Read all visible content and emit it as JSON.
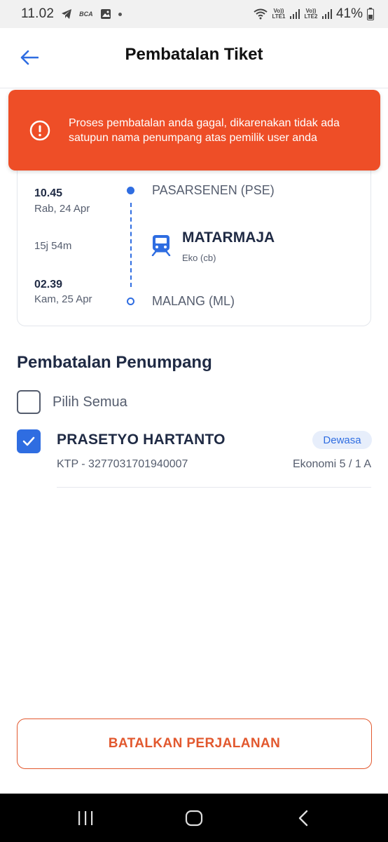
{
  "status_bar": {
    "time": "11.02",
    "bank_label": "BCA",
    "sim1_label": "Vo)) LTE1",
    "sim2_label": "Vo)) LTE2",
    "battery": "41%"
  },
  "header": {
    "title": "Pembatalan Tiket"
  },
  "alert": {
    "message": "Proses pembatalan anda gagal, dikarenakan tidak ada satupun nama penumpang atas pemilik user anda",
    "color": "#ee4e27"
  },
  "journey": {
    "departure_time": "10.45",
    "departure_date": "Rab, 24 Apr",
    "duration": "15j 54m",
    "arrival_time": "02.39",
    "arrival_date": "Kam, 25 Apr",
    "origin": "PASARSENEN (PSE)",
    "destination": "MALANG (ML)",
    "train_name": "MATARMAJA",
    "train_class": "Eko (cb)",
    "accent_color": "#2f6de1"
  },
  "passengers_section": {
    "title": "Pembatalan Penumpang",
    "select_all_label": "Pilih Semua",
    "select_all_checked": false,
    "items": [
      {
        "name": "PRASETYO HARTANTO",
        "type_badge": "Dewasa",
        "id_text": "KTP - 3277031701940007",
        "seat": "Ekonomi 5 / 1 A",
        "checked": true
      }
    ]
  },
  "footer": {
    "cancel_button_label": "BATALKAN PERJALANAN",
    "button_color": "#e2582e"
  },
  "navigation_bar": {
    "buttons": [
      "recents-icon",
      "home-icon",
      "back-icon"
    ]
  }
}
